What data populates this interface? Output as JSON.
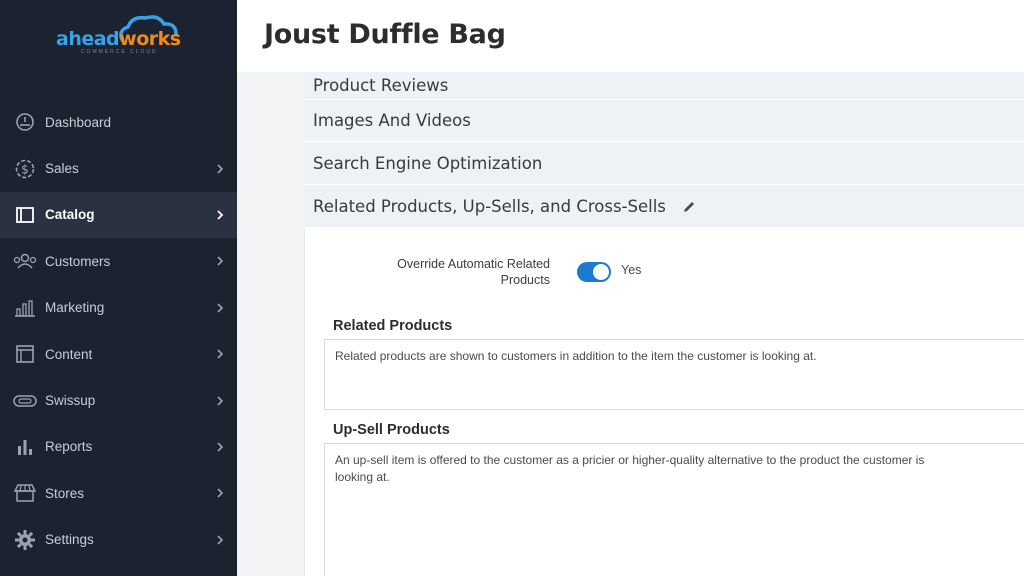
{
  "brand": {
    "logo_part1": "ahead",
    "logo_part2": "works",
    "logo_sub": "COMMERCE CLOUD",
    "color_primary": "#3aa0e8",
    "color_accent": "#f28a1a"
  },
  "sidebar": {
    "background": "#1b2230",
    "items": [
      {
        "label": "Dashboard",
        "icon": "dashboard-icon",
        "has_chevron": false
      },
      {
        "label": "Sales",
        "icon": "dollar-icon",
        "has_chevron": true
      },
      {
        "label": "Catalog",
        "icon": "catalog-icon",
        "has_chevron": true,
        "active": true
      },
      {
        "label": "Customers",
        "icon": "customers-icon",
        "has_chevron": true
      },
      {
        "label": "Marketing",
        "icon": "marketing-icon",
        "has_chevron": true
      },
      {
        "label": "Content",
        "icon": "content-icon",
        "has_chevron": true
      },
      {
        "label": "Swissup",
        "icon": "swissup-icon",
        "has_chevron": true
      },
      {
        "label": "Reports",
        "icon": "reports-icon",
        "has_chevron": true
      },
      {
        "label": "Stores",
        "icon": "stores-icon",
        "has_chevron": true
      },
      {
        "label": "Settings",
        "icon": "gear-icon",
        "has_chevron": true
      }
    ]
  },
  "header": {
    "title": "Joust Duffle Bag"
  },
  "sections": [
    {
      "label": "Product Reviews"
    },
    {
      "label": "Images And Videos"
    },
    {
      "label": "Search Engine Optimization"
    },
    {
      "label": "Related Products, Up-Sells, and Cross-Sells",
      "icon": "pencil-icon"
    }
  ],
  "related": {
    "override_label": "Override Automatic Related Products",
    "override_value": "Yes",
    "toggle_on": true,
    "related_heading": "Related Products",
    "related_desc": "Related products are shown to customers in addition to the item the customer is looking at.",
    "upsell_heading": "Up-Sell Products",
    "upsell_desc": "An up-sell item is offered to the customer as a pricier or higher-quality alternative to the product the customer is looking at."
  }
}
